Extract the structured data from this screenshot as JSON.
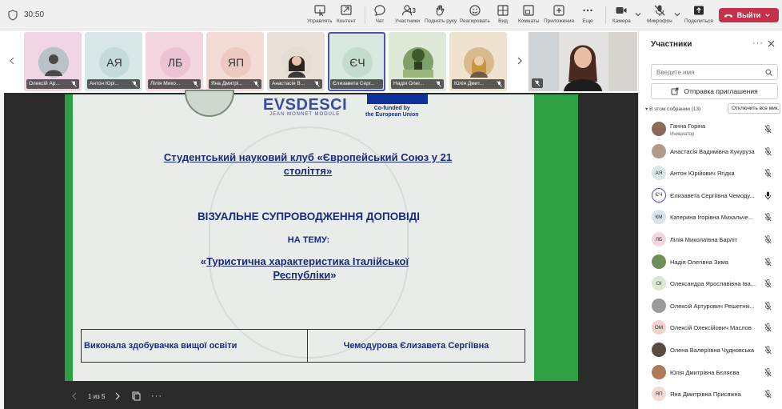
{
  "topbar": {
    "timer": "30:50",
    "controls": [
      {
        "label": "Управлять",
        "icon": "cursor-share-icon"
      },
      {
        "label": "Контент",
        "icon": "content-share-icon"
      },
      {
        "label": "Чат",
        "icon": "chat-icon"
      },
      {
        "label": "Участники",
        "icon": "people-icon"
      },
      {
        "label": "Поднять руку",
        "icon": "raise-hand-icon"
      },
      {
        "label": "Реагировать",
        "icon": "emoji-icon"
      },
      {
        "label": "Вид",
        "icon": "grid-view-icon"
      },
      {
        "label": "Комнаты",
        "icon": "breakout-rooms-icon"
      },
      {
        "label": "Приложения",
        "icon": "add-apps-icon"
      },
      {
        "label": "Еще",
        "icon": "more-icon"
      },
      {
        "label": "Камера",
        "icon": "camera-icon"
      },
      {
        "label": "Микрофон",
        "icon": "mic-off-icon"
      },
      {
        "label": "Поделиться",
        "icon": "share-icon"
      }
    ],
    "participants_count": "13",
    "leave_label": "Выйти",
    "leave_color": "#c4314b"
  },
  "strip": {
    "tiles": [
      {
        "name": "Олексій Ар...",
        "initials": "",
        "bg": "#f0d6e4"
      },
      {
        "name": "Антон Юрі...",
        "initials": "АЯ",
        "bg": "#d7e8e6"
      },
      {
        "name": "Лілія Мико...",
        "initials": "ЛБ",
        "bg": "#f3d6e0"
      },
      {
        "name": "Яна Дмитрі...",
        "initials": "ЯП",
        "bg": "#f3dbd6"
      },
      {
        "name": "Анастасія В...",
        "initials": "",
        "bg": "#e9e1d8"
      },
      {
        "name": "Єлизавета Серг...",
        "initials": "ЄЧ",
        "bg": "#d8e9e0"
      },
      {
        "name": "Надія Олег...",
        "initials": "",
        "bg": "#dfe9d8"
      },
      {
        "name": "Юлія Дмит...",
        "initials": "",
        "bg": "#efe3cf"
      }
    ]
  },
  "slide": {
    "project_logo": "EVSDESCI",
    "project_sub": "JEAN MONNET MODULE",
    "cofunded_1": "Co-funded by",
    "cofunded_2": "the European Union",
    "club_title": "Студентський науковий клуб «Європейський Союз у 21 століття»",
    "heading": "ВІЗУАЛЬНЕ СУПРОВОДЖЕННЯ ДОПОВІДІ",
    "subheading": "НА ТЕМУ:",
    "topic_open": "«",
    "topic": "Туристична характеристика Італійської Республіки",
    "topic_close": "»",
    "author_label": "Виконала здобувачка вищої освіти",
    "author_name": "Чемодурова Єлизавета Сергіївна"
  },
  "slidebar": {
    "page": "1 из 5"
  },
  "panel": {
    "title": "Участники",
    "search_placeholder": "Введите имя",
    "invite_label": "Отправка приглашения",
    "section_label": "В этом собрании (13)",
    "mute_all_label": "Отключить все мик...",
    "participants": [
      {
        "name": "Ганна Горіна",
        "role": "Инициатор",
        "initials": "",
        "bg": "#8a6a5a",
        "mic": "off"
      },
      {
        "name": "Анастасія Вадимівна Кукуруза",
        "role": "",
        "initials": "",
        "bg": "#b09a8a",
        "mic": "off"
      },
      {
        "name": "Антон Юрійович Ягідка",
        "role": "",
        "initials": "АЯ",
        "bg": "#d7e8e6",
        "mic": "off"
      },
      {
        "name": "Єлизавета Сергіївна Чемоду...",
        "role": "",
        "initials": "ЄЧ",
        "bg": "#ffffff",
        "mic": "on"
      },
      {
        "name": "Катерина Ігорівна Михальче...",
        "role": "",
        "initials": "КМ",
        "bg": "#d6e4ef",
        "mic": "off"
      },
      {
        "name": "Лілія Миколаївна Барліт",
        "role": "",
        "initials": "ЛБ",
        "bg": "#f3d6e0",
        "mic": "off"
      },
      {
        "name": "Надія Олегівна Зима",
        "role": "",
        "initials": "",
        "bg": "#6f8f5a",
        "mic": "off"
      },
      {
        "name": "Олександра Ярославівна Іва...",
        "role": "",
        "initials": "ОІ",
        "bg": "#dbe9d3",
        "mic": "off"
      },
      {
        "name": "Олексій Артурович Решетнік...",
        "role": "",
        "initials": "",
        "bg": "#9a9a9a",
        "mic": "off"
      },
      {
        "name": "Олексій Олексійович Маслов",
        "role": "",
        "initials": "ОМ",
        "bg": "#f3d2cc",
        "mic": "off"
      },
      {
        "name": "Олена Валеріївна Чудновська",
        "role": "",
        "initials": "",
        "bg": "#5a4a44",
        "mic": "off"
      },
      {
        "name": "Юлія Дмитрівна Бєляєва",
        "role": "",
        "initials": "",
        "bg": "#b07a5a",
        "mic": "off"
      },
      {
        "name": "Яна Дмитрівна Присяжна",
        "role": "",
        "initials": "ЯП",
        "bg": "#f3dbd6",
        "mic": "off"
      }
    ]
  }
}
